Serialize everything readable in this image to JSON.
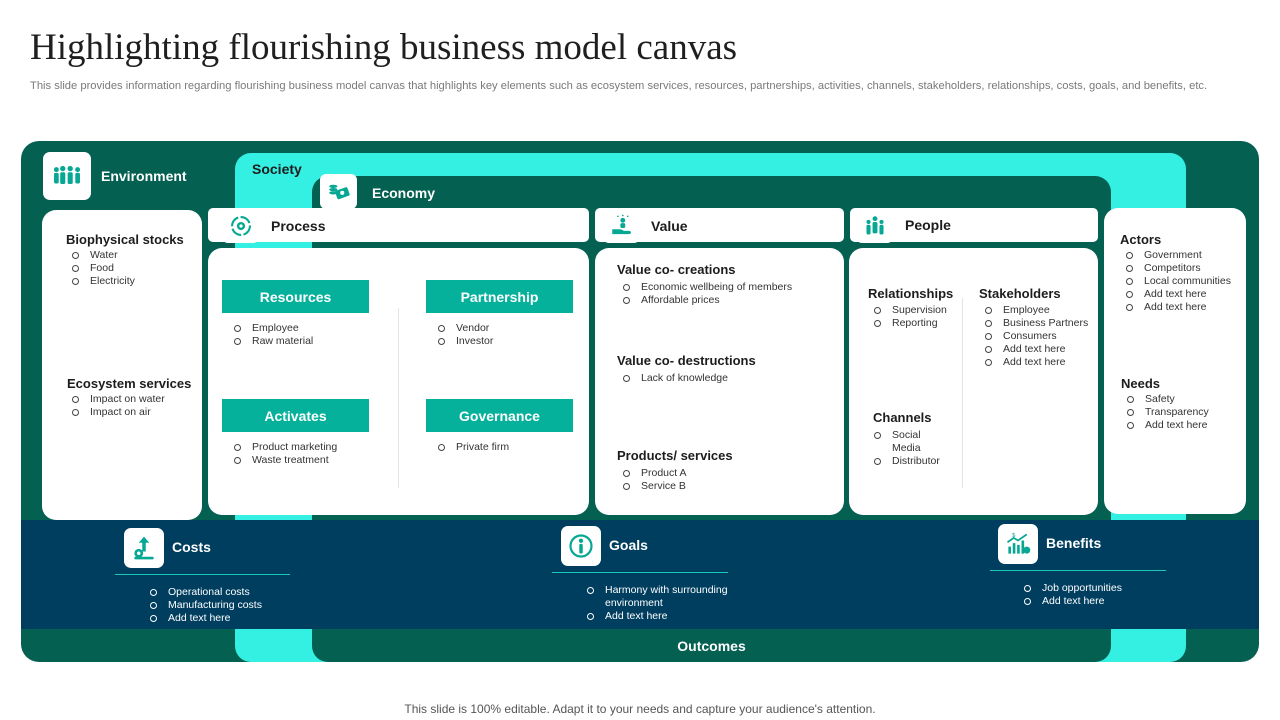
{
  "header": {
    "title": "Highlighting flourishing business model canvas",
    "subtitle": "This slide provides information regarding flourishing business model canvas that highlights key elements such as ecosystem services, resources, partnerships, activities, channels, stakeholders, relationships, costs, goals, and benefits, etc."
  },
  "layers": {
    "environment": "Environment",
    "society": "Society",
    "economy": "Economy",
    "outcomes": "Outcomes"
  },
  "environment_card": {
    "biophysical": {
      "title": "Biophysical stocks",
      "items": [
        "Water",
        "Food",
        "Electricity"
      ]
    },
    "ecosystem": {
      "title": "Ecosystem  services",
      "items": [
        "Impact on water",
        "Impact on air"
      ]
    }
  },
  "process": {
    "label": "Process",
    "resources": {
      "label": "Resources",
      "items": [
        "Employee",
        "Raw material"
      ]
    },
    "partnership": {
      "label": "Partnership",
      "items": [
        "Vendor",
        "Investor"
      ]
    },
    "activates": {
      "label": "Activates",
      "items": [
        "Product marketing",
        "Waste treatment"
      ]
    },
    "governance": {
      "label": "Governance",
      "items": [
        "Private firm"
      ]
    }
  },
  "value": {
    "label": "Value",
    "creations": {
      "title": "Value co- creations",
      "items": [
        "Economic wellbeing of members",
        "Affordable prices"
      ]
    },
    "destructions": {
      "title": "Value co- destructions",
      "items": [
        "Lack of knowledge"
      ]
    },
    "products": {
      "title": "Products/ services",
      "items": [
        "Product A",
        "Service B"
      ]
    }
  },
  "people": {
    "label": "People",
    "relationships": {
      "title": "Relationships",
      "items": [
        "Supervision",
        "Reporting"
      ]
    },
    "channels": {
      "title": "Channels",
      "items": [
        "Social",
        "Media",
        "Distributor"
      ]
    },
    "stakeholders": {
      "title": "Stakeholders",
      "items": [
        "Employee",
        "Business Partners",
        "Consumers",
        "Add text here",
        "Add text here"
      ]
    }
  },
  "society_card": {
    "actors": {
      "title": "Actors",
      "items": [
        "Government",
        "Competitors",
        "Local communities",
        "Add text here",
        "Add text here"
      ]
    },
    "needs": {
      "title": "Needs",
      "items": [
        "Safety",
        "Transparency",
        "Add text here"
      ]
    }
  },
  "outcomes": {
    "costs": {
      "label": "Costs",
      "items": [
        "Operational costs",
        "Manufacturing costs",
        "Add text here"
      ]
    },
    "goals": {
      "label": "Goals",
      "items": [
        "Harmony with surrounding",
        "environment",
        "Add text here"
      ]
    },
    "benefits": {
      "label": "Benefits",
      "items": [
        "Job opportunities",
        "Add text here"
      ]
    }
  },
  "colors": {
    "dark_teal": "#046152",
    "aqua": "#33f0e2",
    "navy": "#003e5f",
    "teal_button": "#06b19c"
  },
  "icons": {
    "environment": "people-group-icon",
    "economy": "money-icon",
    "process": "gear-cycle-icon",
    "value": "hand-person-icon",
    "people": "team-icon",
    "costs": "cost-growth-icon",
    "goals": "target-person-icon",
    "benefits": "benefit-chart-icon"
  },
  "footer": {
    "text": "This slide is 100% editable. Adapt it to your needs and capture your audience's attention."
  }
}
